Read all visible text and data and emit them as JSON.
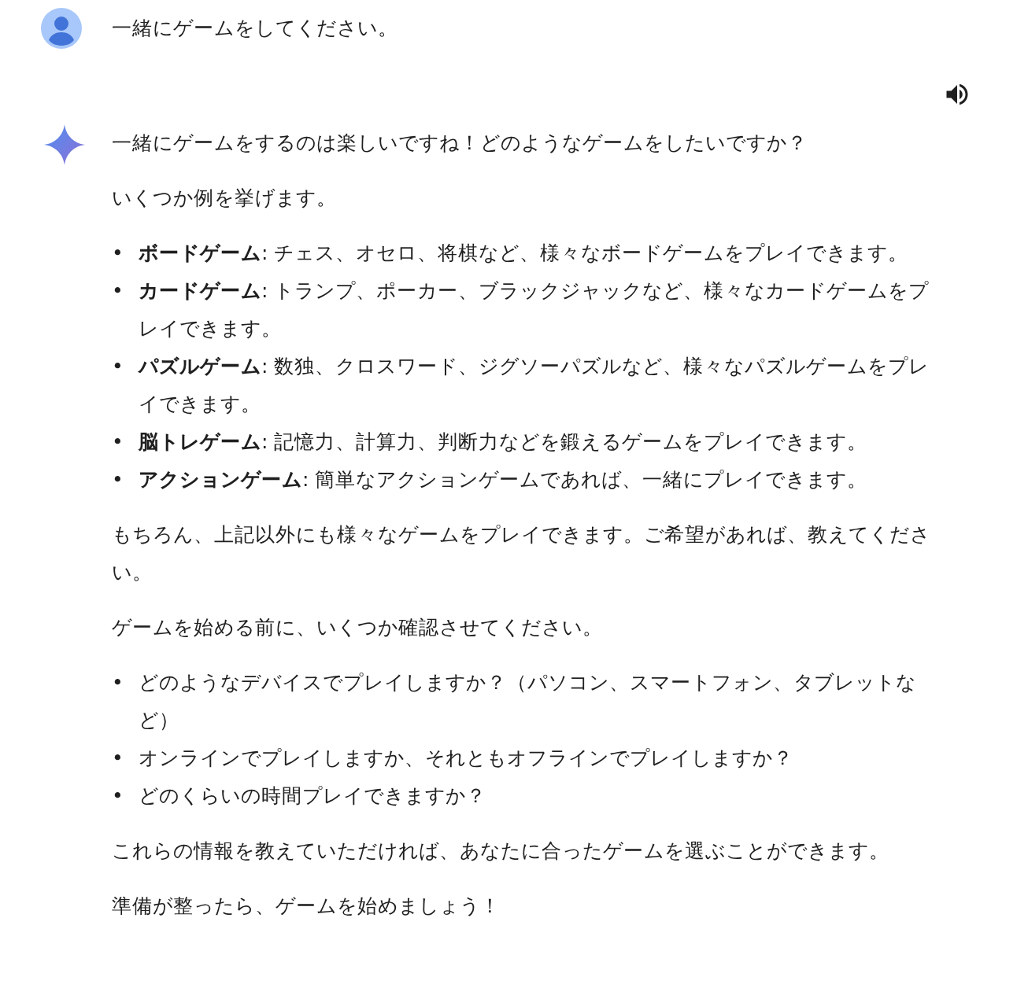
{
  "user_message": {
    "text": "一緒にゲームをしてください。"
  },
  "response": {
    "blocks": [
      {
        "kind": "paragraph",
        "text": "一緒にゲームをするのは楽しいですね！どのようなゲームをしたいですか？"
      },
      {
        "kind": "paragraph",
        "text": "いくつか例を挙げます。"
      },
      {
        "kind": "bullets",
        "items": [
          {
            "marker": "•",
            "text": "**ボードゲーム**: チェス、オセロ、将棋など、様々なボードゲームをプレイできます。"
          },
          {
            "marker": "•",
            "text": "**カードゲーム**: トランプ、ポーカー、ブラックジャックなど、様々なカードゲームをプレイできます。"
          },
          {
            "marker": "•",
            "text": "**パズルゲーム**: 数独、クロスワード、ジグソーパズルなど、様々なパズルゲームをプレイできます。"
          },
          {
            "marker": "•",
            "text": "**脳トレゲーム**: 記憶力、計算力、判断力などを鍛えるゲームをプレイできます。"
          },
          {
            "marker": "•",
            "text": "**アクションゲーム**: 簡単なアクションゲームであれば、一緒にプレイできます。"
          }
        ]
      },
      {
        "kind": "paragraph",
        "text": "もちろん、上記以外にも様々なゲームをプレイできます。ご希望があれば、教えてください。"
      },
      {
        "kind": "paragraph",
        "text": "ゲームを始める前に、いくつか確認させてください。"
      },
      {
        "kind": "bullets",
        "items": [
          {
            "marker": "•",
            "text": "どのようなデバイスでプレイしますか？（パソコン、スマートフォン、タブレットなど）"
          },
          {
            "marker": "•",
            "text": "オンラインでプレイしますか、それともオフラインでプレイしますか？"
          },
          {
            "marker": "•",
            "text": "どのくらいの時間プレイできますか？"
          }
        ]
      },
      {
        "kind": "paragraph",
        "text": "これらの情報を教えていただければ、あなたに合ったゲームを選ぶことができます。"
      },
      {
        "kind": "paragraph",
        "text": "準備が整ったら、ゲームを始めましょう！"
      }
    ]
  }
}
